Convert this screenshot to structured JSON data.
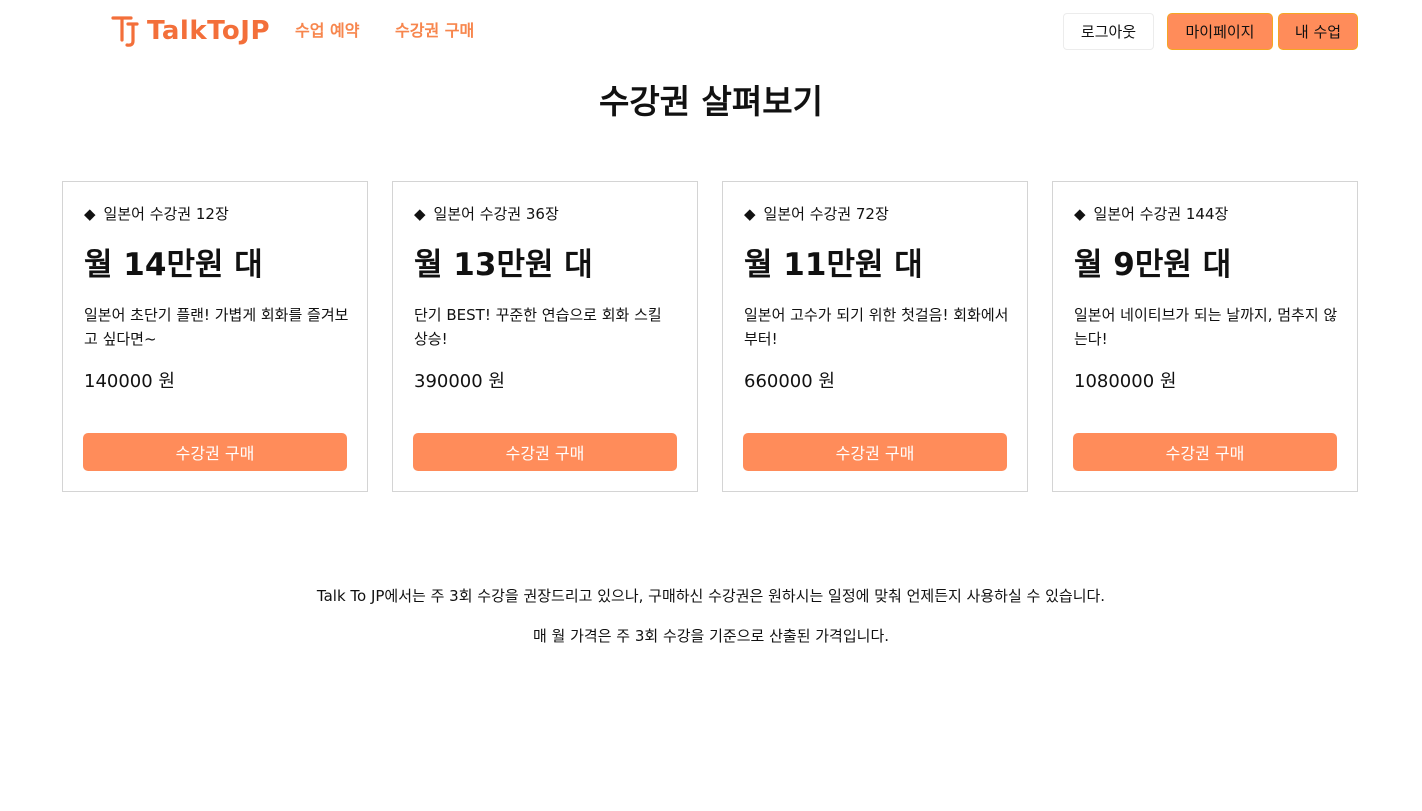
{
  "header": {
    "logo_text": "TalkToJP",
    "nav": {
      "reserve_label": "수업 예약",
      "buy_label": "수강권 구매"
    },
    "logout_label": "로그아웃",
    "mypage_label": "마이페이지",
    "myclass_label": "내 수업"
  },
  "colors": {
    "brand": "#f36f3a",
    "accent": "#ff8c5a"
  },
  "page": {
    "title": "수강권 살펴보기"
  },
  "cards": [
    {
      "subtitle": "일본어 수강권 12장",
      "heading": "월 14만원 대",
      "description": "일본어 초단기 플랜! 가볍게 회화를 즐겨보고 싶다면~",
      "price": "140000 원",
      "button_label": "수강권 구매"
    },
    {
      "subtitle": "일본어 수강권 36장",
      "heading": "월 13만원 대",
      "description": "단기 BEST! 꾸준한 연습으로 회화 스킬 상승!",
      "price": "390000 원",
      "button_label": "수강권 구매"
    },
    {
      "subtitle": "일본어 수강권 72장",
      "heading": "월 11만원 대",
      "description": "일본어 고수가 되기 위한 첫걸음! 회화에서 부터!",
      "price": "660000 원",
      "button_label": "수강권 구매"
    },
    {
      "subtitle": "일본어 수강권 144장",
      "heading": "월 9만원 대",
      "description": "일본어 네이티브가 되는 날까지, 멈추지 않는다!",
      "price": "1080000 원",
      "button_label": "수강권 구매"
    }
  ],
  "notices": [
    "Talk To JP에서는 주 3회 수강을 권장드리고 있으나, 구매하신 수강권은 원하시는 일정에 맞춰 언제든지 사용하실 수 있습니다.",
    "매 월 가격은 주 3회 수강을 기준으로 산출된 가격입니다."
  ]
}
